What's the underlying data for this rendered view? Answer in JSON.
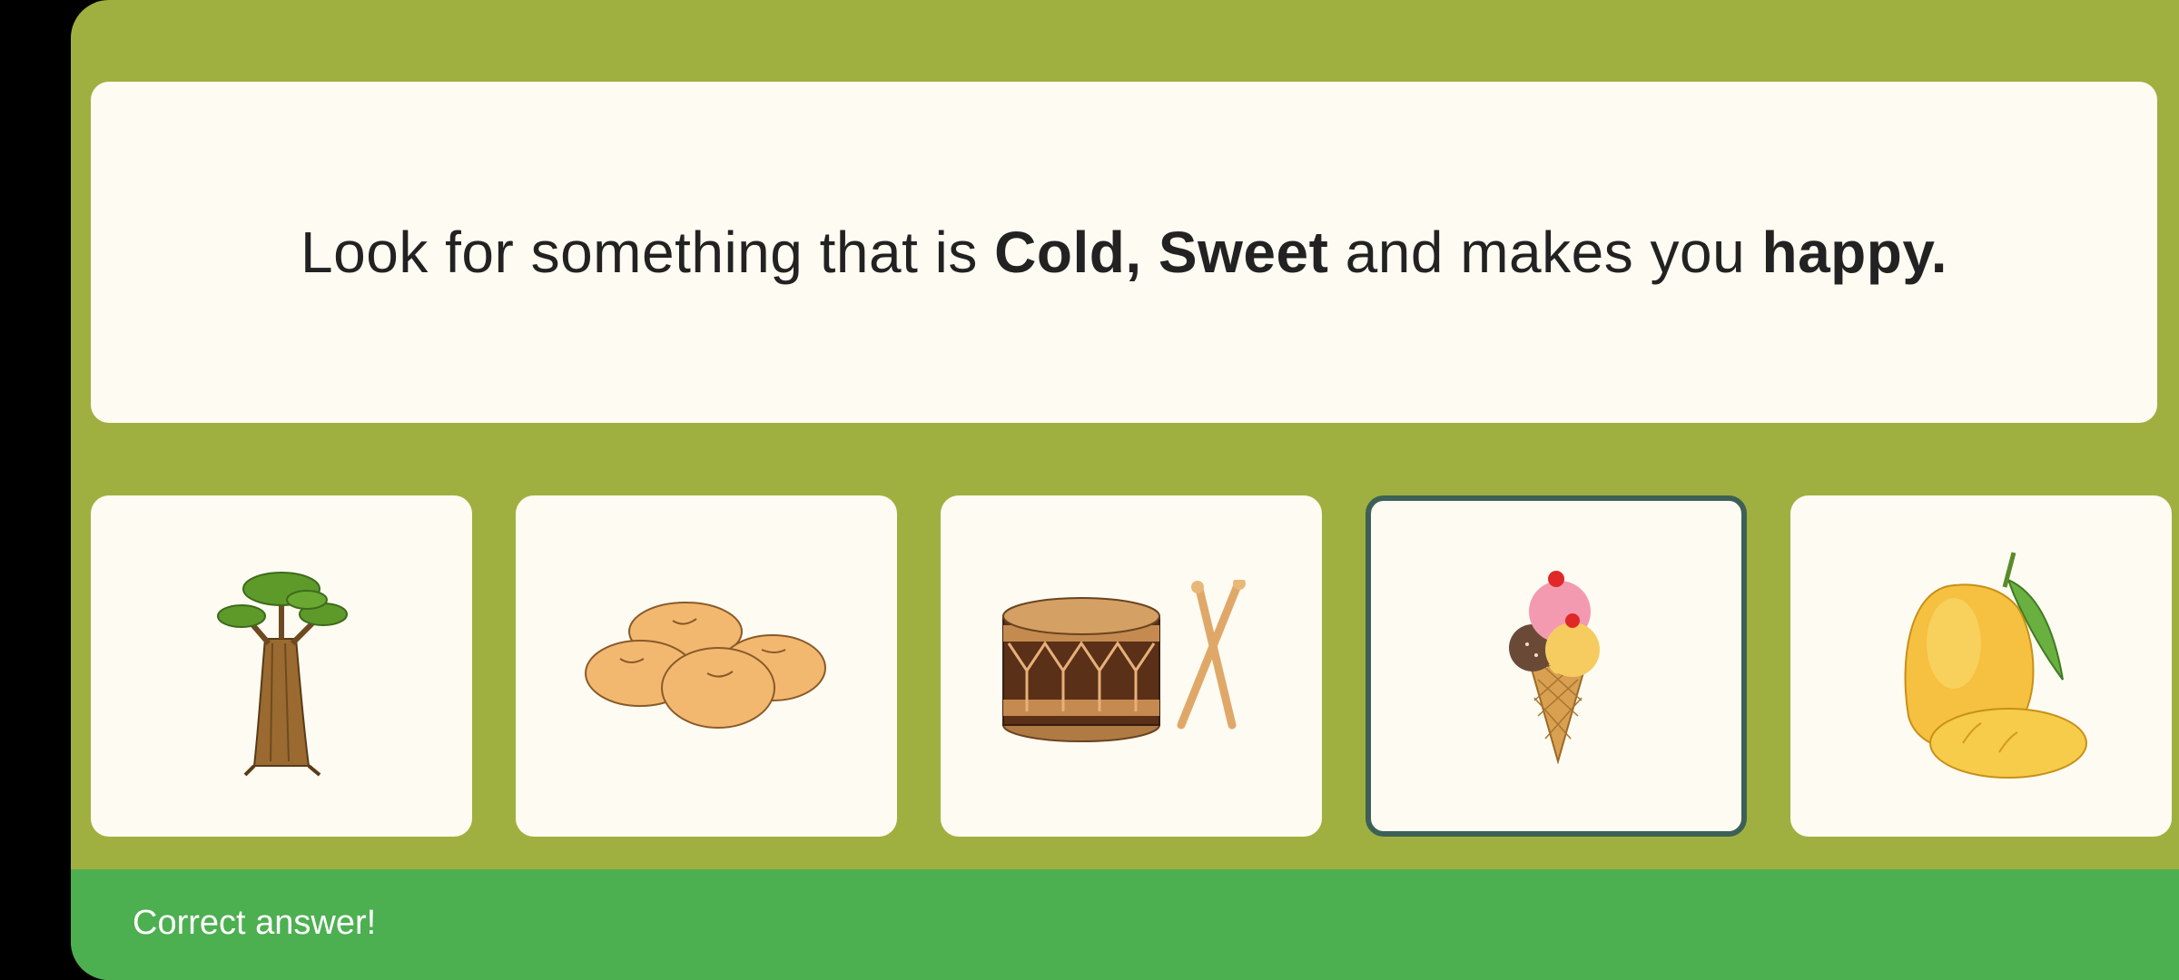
{
  "question": {
    "part1": "Look for something that is ",
    "bold1": "Cold, Sweet",
    "part2": " and makes you ",
    "bold2": "happy."
  },
  "options": [
    {
      "icon": "baobab-tree-icon",
      "selected": false
    },
    {
      "icon": "peanuts-icon",
      "selected": false
    },
    {
      "icon": "drum-icon",
      "selected": false
    },
    {
      "icon": "ice-cream-cone-icon",
      "selected": true
    },
    {
      "icon": "mango-icon",
      "selected": false
    }
  ],
  "feedback": {
    "text": "Correct answer!"
  },
  "colors": {
    "background": "#a0b040",
    "card": "#fdfbf2",
    "selected_border": "#3d6056",
    "feedback_bar": "#4caf50"
  }
}
